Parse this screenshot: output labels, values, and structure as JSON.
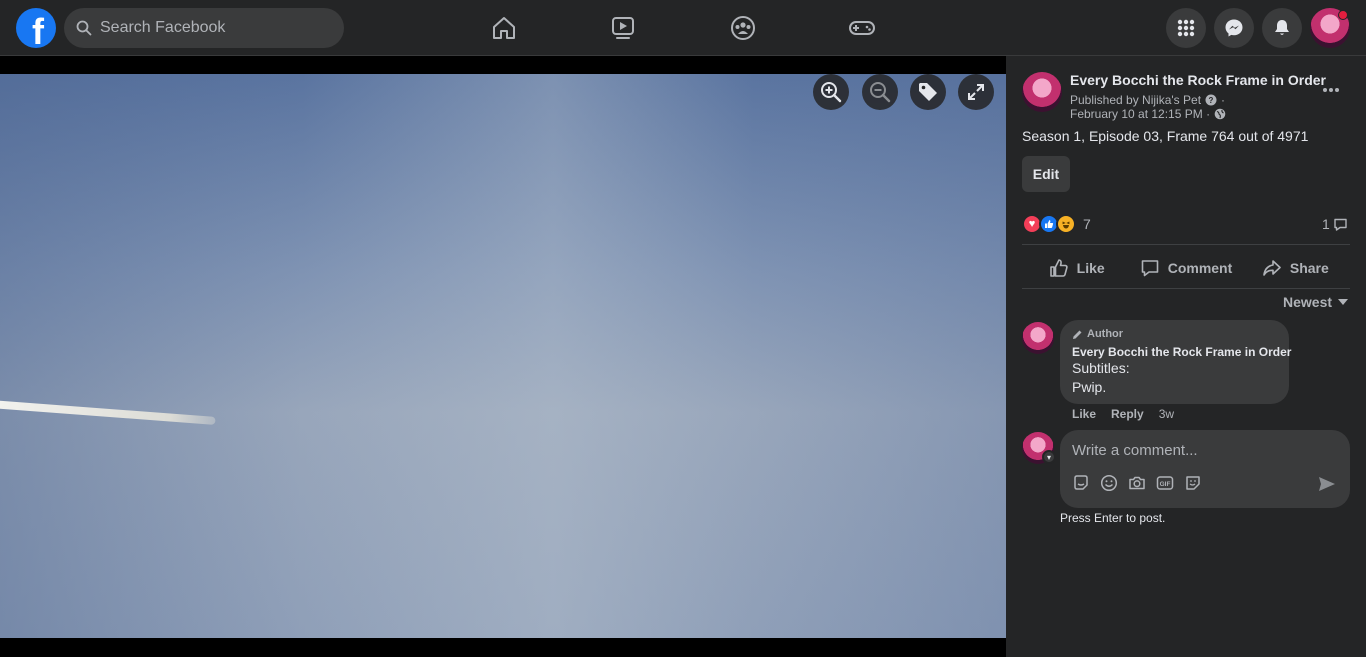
{
  "topbar": {
    "search_placeholder": "Search Facebook",
    "logo_letter": "f",
    "brand_color": "#1877f2",
    "nav": [
      "home-icon",
      "watch-icon",
      "groups-icon",
      "gaming-icon"
    ],
    "right_buttons": [
      "menu-grid-icon",
      "messenger-icon",
      "notifications-icon"
    ],
    "notification_dot_color": "#e41e3f"
  },
  "post": {
    "page_name": "Every Bocchi the Rock Frame in Order",
    "published_by": "Published by Nijika's Pet",
    "date": "February 10 at 12:15 PM ·",
    "caption": "Season 1, Episode 03, Frame 764 out of 4971",
    "edit_label": "Edit",
    "reactions_count": "7",
    "comments_count": "1",
    "actions": {
      "like": "Like",
      "comment": "Comment",
      "share": "Share"
    },
    "sort_label": "Newest"
  },
  "comment": {
    "badge": "Author",
    "name": "Every Bocchi the Rock Frame in Order",
    "line1": "Subtitles:",
    "line2": "Pwip.",
    "like": "Like",
    "reply": "Reply",
    "time": "3w"
  },
  "composer": {
    "placeholder": "Write a comment...",
    "hint": "Press Enter to post.",
    "tools": [
      "avatar-sticker-icon",
      "emoji-icon",
      "camera-icon",
      "gif-icon",
      "sticker-icon"
    ]
  }
}
